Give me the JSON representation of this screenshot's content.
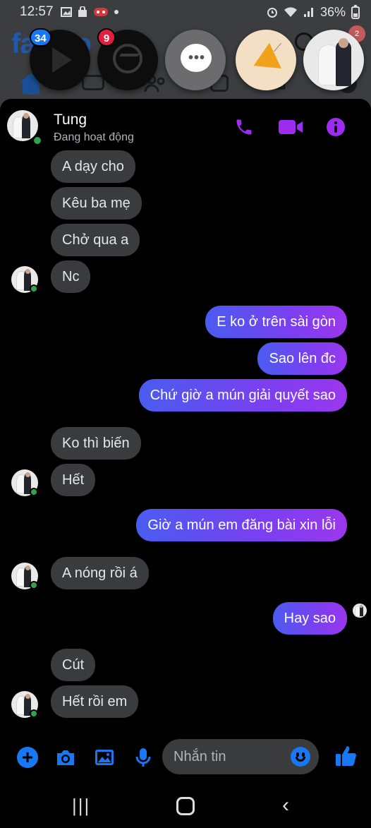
{
  "status_bar": {
    "time": "12:57",
    "battery": "36%"
  },
  "facebook_backdrop": {
    "logo_left": "fa",
    "logo_right": "o",
    "badges": {
      "video_head": "34",
      "messenger_head": "9",
      "profile": "2"
    }
  },
  "chat_heads": [
    "play-icon",
    "messenger-icon",
    "chat-bubble-icon",
    "megaphone-icon",
    "profile-photo"
  ],
  "conversation": {
    "contact_name": "Tung",
    "contact_status": "Đang hoạt động",
    "accent_color": "#9b2cf0",
    "messages": [
      {
        "from": "them",
        "text": "A dạy cho"
      },
      {
        "from": "them",
        "text": "Kêu ba mẹ"
      },
      {
        "from": "them",
        "text": "Chở qua a"
      },
      {
        "from": "them",
        "text": "Nc"
      },
      {
        "from": "me",
        "text": "E ko ở trên sài gòn"
      },
      {
        "from": "me",
        "text": "Sao lên đc"
      },
      {
        "from": "me",
        "text": "Chứ giờ a mún giải quyết sao"
      },
      {
        "from": "them",
        "text": "Ko thì biến"
      },
      {
        "from": "them",
        "text": "Hết"
      },
      {
        "from": "me",
        "text": "Giờ a mún em đăng bài xin lỗi"
      },
      {
        "from": "them",
        "text": "A nóng rồi á"
      },
      {
        "from": "me",
        "text": "Hay sao"
      },
      {
        "from": "them",
        "text": "Cút"
      },
      {
        "from": "them",
        "text": "Hết rồi em"
      }
    ]
  },
  "composer": {
    "placeholder": "Nhắn tin",
    "accent_color": "#1877f2"
  }
}
